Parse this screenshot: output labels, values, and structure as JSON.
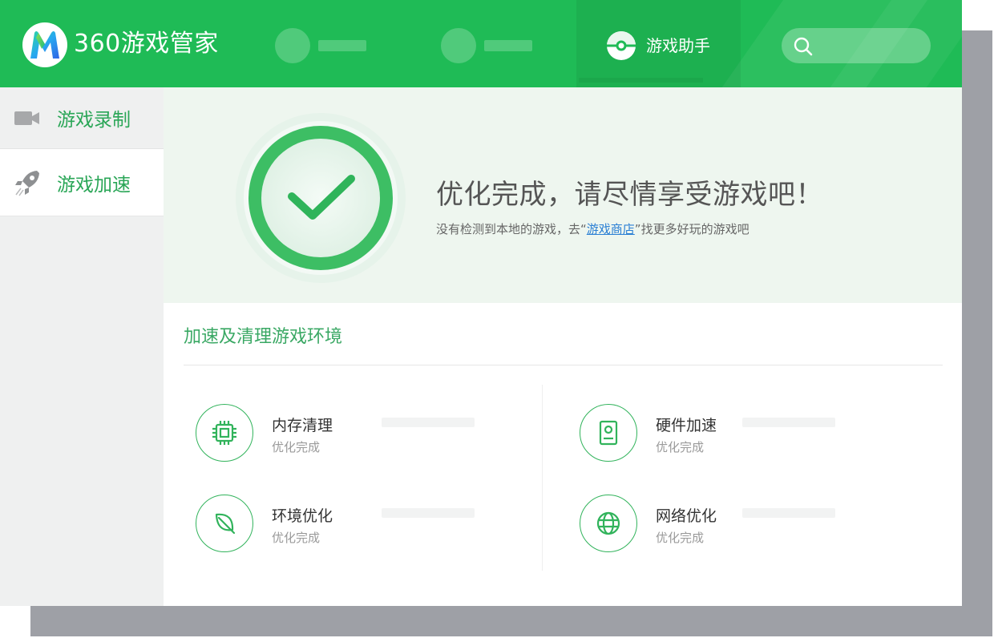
{
  "app": {
    "title": "360游戏管家"
  },
  "nav": {
    "helper_label": "游戏助手"
  },
  "sidebar": {
    "items": [
      {
        "label": "游戏录制",
        "icon": "video-camera-icon"
      },
      {
        "label": "游戏加速",
        "icon": "rocket-icon"
      }
    ]
  },
  "hero": {
    "title": "优化完成，请尽情享受游戏吧！",
    "sub_prefix": "没有检测到本地的游戏，去“",
    "sub_link": "游戏商店",
    "sub_suffix": "”找更多好玩的游戏吧"
  },
  "section": {
    "title": "加速及清理游戏环境"
  },
  "optimizations": [
    {
      "name": "内存清理",
      "status": "优化完成",
      "icon": "chip-icon"
    },
    {
      "name": "硬件加速",
      "status": "优化完成",
      "icon": "hard-drive-icon"
    },
    {
      "name": "环境优化",
      "status": "优化完成",
      "icon": "leaf-icon"
    },
    {
      "name": "网络优化",
      "status": "优化完成",
      "icon": "globe-icon"
    }
  ],
  "colors": {
    "brand_green": "#1fbb56",
    "accent_green": "#31b35b",
    "link_blue": "#2a7fd4"
  }
}
